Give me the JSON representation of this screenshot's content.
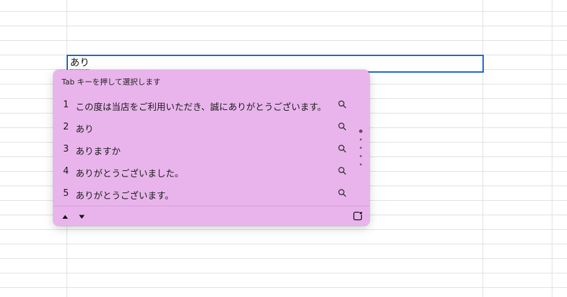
{
  "cell": {
    "text": "あり"
  },
  "ime": {
    "hint": "Tab キーを押して選択します",
    "candidates": [
      {
        "num": "1",
        "text": "この度は当店をご利用いただき、誠にありがとうございます。"
      },
      {
        "num": "2",
        "text": "あり"
      },
      {
        "num": "3",
        "text": "ありますか"
      },
      {
        "num": "4",
        "text": "ありがとうございました。"
      },
      {
        "num": "5",
        "text": "ありがとうございます。"
      }
    ],
    "icons": {
      "candidate": "search-icon",
      "prev": "triangle-up-icon",
      "next": "triangle-down-icon",
      "favorite": "favorite-heart-icon"
    },
    "colors": {
      "background": "#e9b4ec",
      "cell_border": "#1a66c9"
    }
  }
}
